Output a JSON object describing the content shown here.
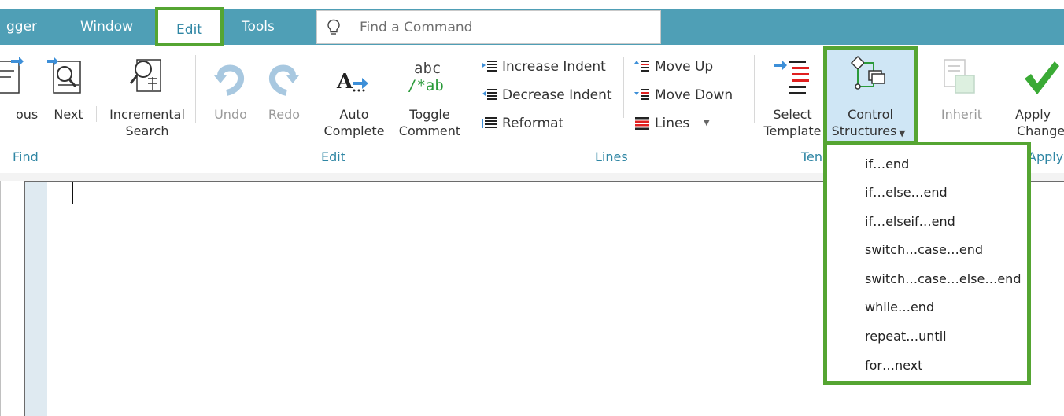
{
  "menubar": {
    "tabs": [
      {
        "label": "gger"
      },
      {
        "label": "Window"
      },
      {
        "label": "Edit"
      },
      {
        "label": "Tools"
      }
    ],
    "search_placeholder": "Find a Command"
  },
  "ribbon": {
    "find_group": {
      "previous_label": "ous",
      "next_label": "Next",
      "incremental_search_label_1": "Incremental",
      "incremental_search_label_2": "Search",
      "group_label": "Find"
    },
    "edit_group": {
      "undo_label": "Undo",
      "redo_label": "Redo",
      "auto_complete_label_1": "Auto",
      "auto_complete_label_2": "Complete",
      "toggle_comment_label_1": "Toggle",
      "toggle_comment_label_2": "Comment",
      "toggle_comment_icon_text_1": "abc",
      "toggle_comment_icon_text_2": "/*ab",
      "group_label": "Edit"
    },
    "lines_group": {
      "increase_indent": "Increase Indent",
      "decrease_indent": "Decrease Indent",
      "reformat": "Reformat",
      "move_up": "Move Up",
      "move_down": "Move Down",
      "lines": "Lines",
      "group_label": "Lines"
    },
    "template_group": {
      "select_template_label_1": "Select",
      "select_template_label_2": "Template",
      "control_structures_label_1": "Control",
      "control_structures_label_2": "Structures",
      "inherit_label": "Inherit",
      "group_label": "Ten"
    },
    "apply_group": {
      "apply_label_1": "Apply",
      "apply_label_2": "Change",
      "group_label": "Apply"
    }
  },
  "dropdown": {
    "items": [
      "if…end",
      "if…else…end",
      "if…elseif…end",
      "switch…case…end",
      "switch…case…else…end",
      "while…end",
      "repeat…until",
      "for…next"
    ]
  },
  "colors": {
    "menubar_bg": "#4f9fb6",
    "highlight": "#55a532",
    "group_label": "#2f86a4",
    "lines_red": "#e02020",
    "apply_green": "#3aaa35"
  }
}
